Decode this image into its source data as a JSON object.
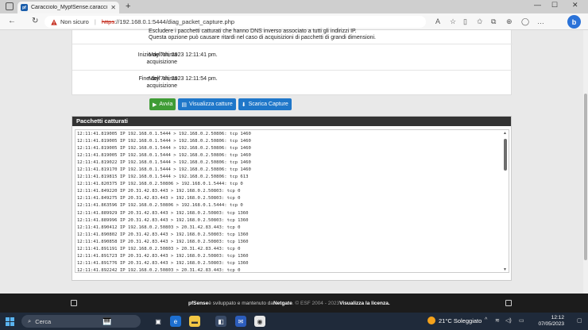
{
  "browser": {
    "tab_title": "Caracciolo_MypfSense.caracciolo",
    "security_label": "Non sicuro",
    "url_scheme": "https",
    "url_rest": "://192.168.0.1:5444/diag_packet_capture.php"
  },
  "info": {
    "partial_text_1": "Escludere i pacchetti catturati che hanno DNS inverso associato a tutti gli indirizzi IP.",
    "partial_text_2": "Questa opzione può causare ritardi nel caso di acquisizioni di pacchetti di grandi dimensioni.",
    "start_label": "Inizio dell'ultima acquisizione",
    "start_value": "May 7th, 2023 12:11:41 pm.",
    "end_label": "Fine dell' ultima acquisizione",
    "end_value": "May 7th, 2023 12:11:54 pm."
  },
  "buttons": {
    "start": "Avvia",
    "view": "Visualizza catture",
    "download": "Scarica Capture"
  },
  "capture_panel": {
    "title": "Pacchetti catturati",
    "lines": [
      "12:11:41.819005 IP 192.168.0.1.5444 > 192.168.0.2.50806: tcp 1460",
      "12:11:41.819005 IP 192.168.0.1.5444 > 192.168.0.2.50806: tcp 1460",
      "12:11:41.819005 IP 192.168.0.1.5444 > 192.168.0.2.50806: tcp 1460",
      "12:11:41.819005 IP 192.168.0.1.5444 > 192.168.0.2.50806: tcp 1460",
      "12:11:41.819022 IP 192.168.0.1.5444 > 192.168.0.2.50806: tcp 1460",
      "12:11:41.819170 IP 192.168.0.1.5444 > 192.168.0.2.50806: tcp 1460",
      "12:11:41.819815 IP 192.168.0.1.5444 > 192.168.0.2.50806: tcp 613",
      "12:11:41.820375 IP 192.168.0.2.50806 > 192.168.0.1.5444: tcp 0",
      "12:11:41.849220 IP 20.31.42.83.443 > 192.168.0.2.50803: tcp 0",
      "12:11:41.849275 IP 20.31.42.83.443 > 192.168.0.2.50803: tcp 0",
      "12:11:41.863596 IP 192.168.0.2.50806 > 192.168.0.1.5444: tcp 0",
      "12:11:41.889929 IP 20.31.42.83.443 > 192.168.0.2.50803: tcp 1360",
      "12:11:41.889996 IP 20.31.42.83.443 > 192.168.0.2.50803: tcp 1360",
      "12:11:41.890412 IP 192.168.0.2.50803 > 20.31.42.83.443: tcp 0",
      "12:11:41.890802 IP 20.31.42.83.443 > 192.168.0.2.50803: tcp 1360",
      "12:11:41.890858 IP 20.31.42.83.443 > 192.168.0.2.50803: tcp 1360",
      "12:11:41.891191 IP 192.168.0.2.50803 > 20.31.42.83.443: tcp 0",
      "12:11:41.891723 IP 20.31.42.83.443 > 192.168.0.2.50803: tcp 1360",
      "12:11:41.891776 IP 20.31.42.83.443 > 192.168.0.2.50803: tcp 1360",
      "12:11:41.892242 IP 192.168.0.2.50803 > 20.31.42.83.443: tcp 0"
    ]
  },
  "footer": {
    "brand": "pfSense",
    "text1": "è sviluppato e mantenuto da",
    "company": "Netgate",
    "text2": ". © ESF 2004 - 2023",
    "license_link": "Visualizza la licenza."
  },
  "taskbar": {
    "search_label": "Cerca",
    "weather": "21°C Soleggiato",
    "time": "12:12",
    "date": "07/05/2023"
  },
  "colors": {
    "accent_green": "#3f9c35",
    "accent_blue": "#1f77c9",
    "panel_header": "#333333"
  }
}
